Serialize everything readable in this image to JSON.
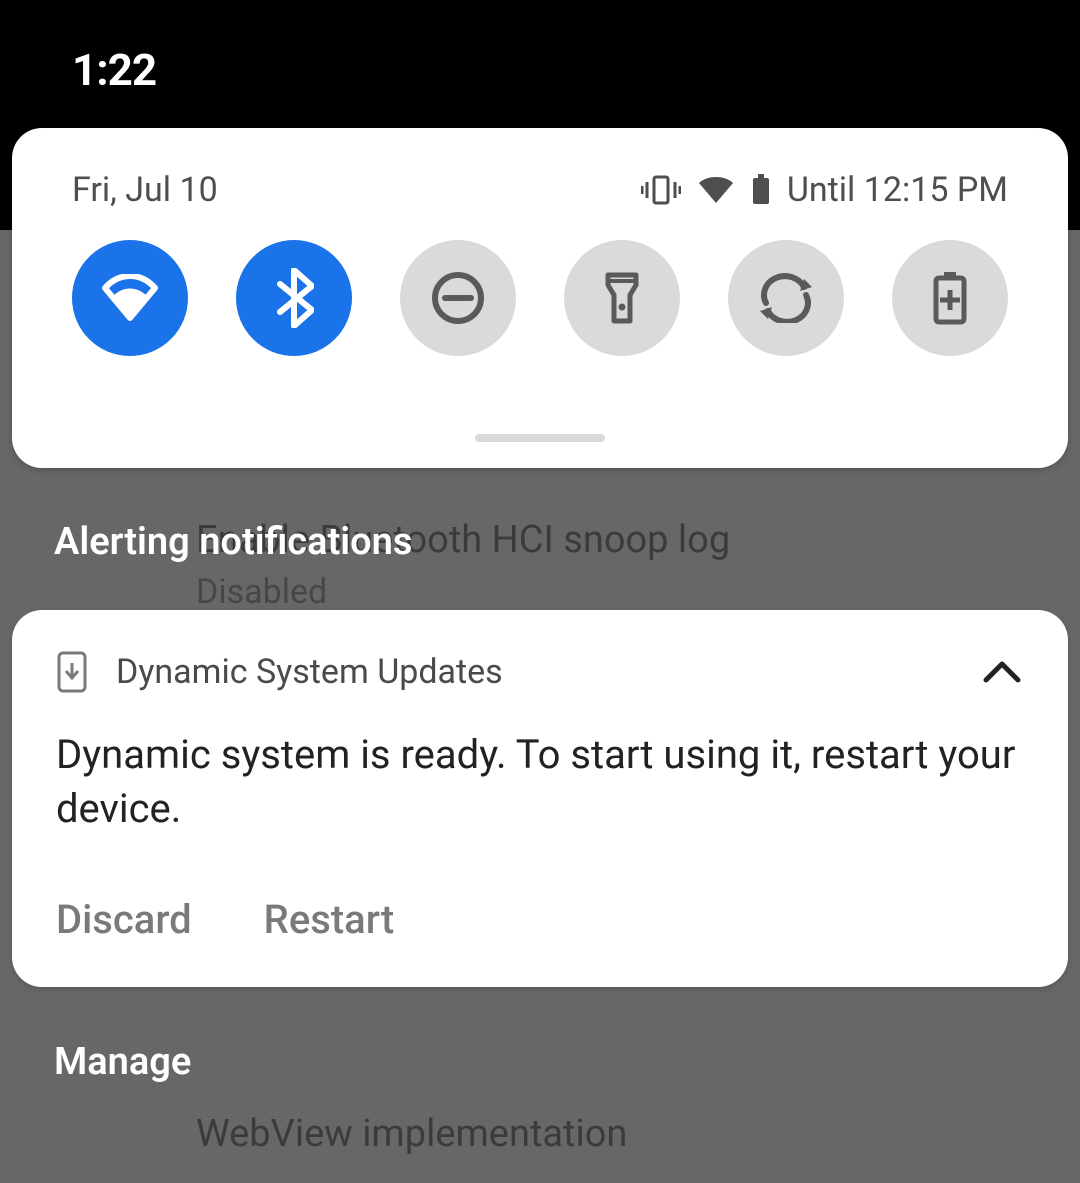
{
  "status": {
    "time": "1:22"
  },
  "quick_settings": {
    "date": "Fri, Jul 10",
    "battery_note": "Until 12:15 PM",
    "tiles": [
      {
        "name": "wifi",
        "active": true
      },
      {
        "name": "bluetooth",
        "active": true
      },
      {
        "name": "do-not-disturb",
        "active": false
      },
      {
        "name": "flashlight",
        "active": false
      },
      {
        "name": "auto-rotate",
        "active": false
      },
      {
        "name": "battery-saver",
        "active": false
      }
    ]
  },
  "shade": {
    "alerting_header": "Alerting notifications",
    "manage_label": "Manage"
  },
  "notification": {
    "app_name": "Dynamic System Updates",
    "body": "Dynamic system is ready. To start using it, restart your device.",
    "actions": {
      "discard": "Discard",
      "restart": "Restart"
    }
  },
  "background_settings": {
    "row1_title": "Enable Bluetooth HCI snoop log",
    "row1_sub": "Disabled",
    "row2_title": "WebView implementation"
  }
}
